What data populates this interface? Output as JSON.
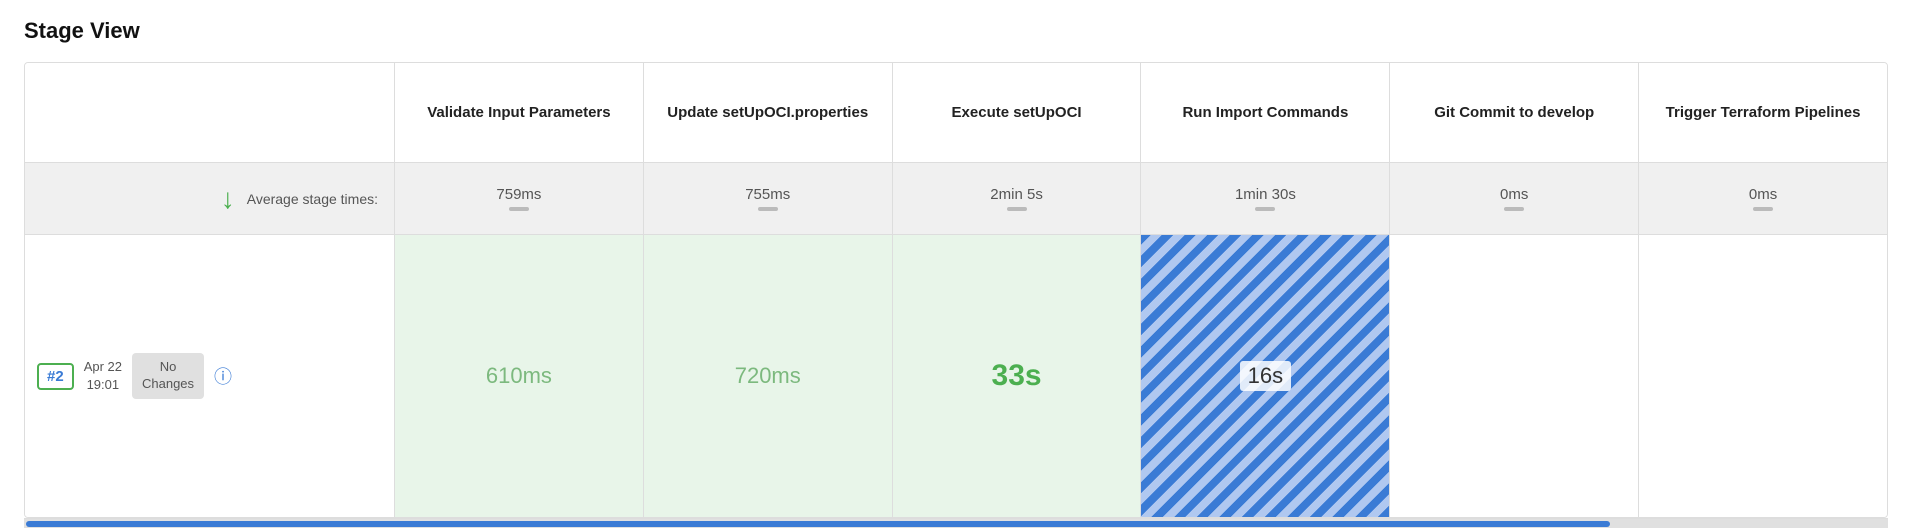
{
  "title": "Stage View",
  "left": {
    "avg_label": "Average stage times:",
    "arrow": "↓",
    "build": {
      "number": "#2",
      "date_line1": "Apr 22",
      "date_line2": "19:01",
      "no_changes": "No\nChanges"
    }
  },
  "stages": [
    {
      "id": "validate",
      "header": "Validate Input Parameters",
      "avg_time": "759ms",
      "build_time": "610ms",
      "build_style": "green-light"
    },
    {
      "id": "update-setupoci",
      "header": "Update setUpOCI.properties",
      "avg_time": "755ms",
      "build_time": "720ms",
      "build_style": "green-medium"
    },
    {
      "id": "execute-setupoci",
      "header": "Execute setUpOCI",
      "avg_time": "2min 5s",
      "build_time": "33s",
      "build_style": "green-strong"
    },
    {
      "id": "run-import",
      "header": "Run Import Commands",
      "avg_time": "1min 30s",
      "build_time": "16s",
      "build_style": "blue-striped"
    },
    {
      "id": "git-commit",
      "header": "Git Commit to develop",
      "avg_time": "0ms",
      "build_time": "",
      "build_style": "plain"
    },
    {
      "id": "trigger-terraform",
      "header": "Trigger Terraform Pipelines",
      "avg_time": "0ms",
      "build_time": "",
      "build_style": "plain"
    }
  ],
  "icons": {
    "info": "ⓘ"
  }
}
